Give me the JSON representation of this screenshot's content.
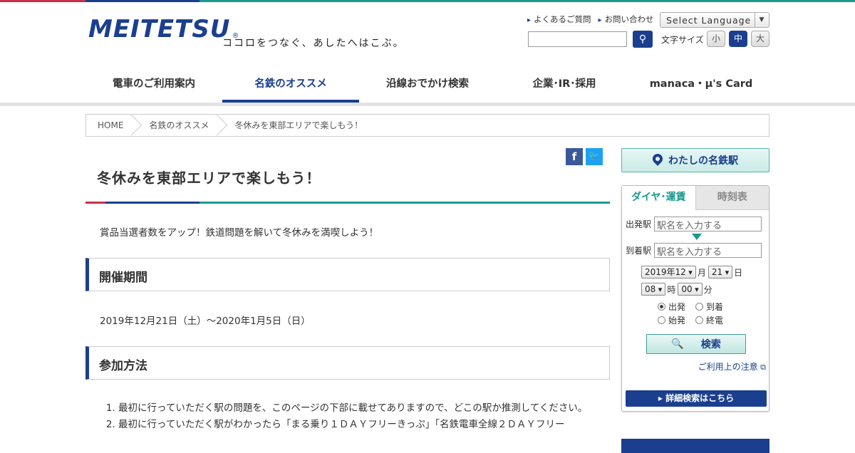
{
  "brand": {
    "name": "MEITETSU",
    "tagline": "ココロをつなぐ、あしたへはこぶ。"
  },
  "utility": {
    "faq": "よくあるご質問",
    "contact": "お問い合わせ",
    "language": "Select Language",
    "font_size_label": "文字サイズ",
    "font_small": "小",
    "font_medium": "中",
    "font_large": "大"
  },
  "gnav": [
    "電車のご利用案内",
    "名鉄のオススメ",
    "沿線おでかけ検索",
    "企業･IR･採用",
    "manaca・μ's Card"
  ],
  "breadcrumb": [
    "HOME",
    "名鉄のオススメ",
    "冬休みを東部エリアで楽しもう！"
  ],
  "main": {
    "title": "冬休みを東部エリアで楽しもう！",
    "lead": "賞品当選者数をアップ！鉄道問題を解いて冬休みを満喫しよう！",
    "section1_title": "開催期間",
    "period": "2019年12月21日（土）～2020年1月5日（日）",
    "section2_title": "参加方法",
    "steps": [
      "最初に行っていただく駅の問題を、このページの下部に載せてありますので、どこの駅か推測してください。",
      "最初に行っていただく駅がわかったら「まる乗り１ＤＡＹフリーきっぷ」「名鉄電車全線２ＤＡＹフリー"
    ]
  },
  "social": {
    "facebook": "f",
    "twitter": "t"
  },
  "sidebar": {
    "my_meitetsu": "わたしの名鉄駅",
    "tab_diagram": "ダイヤ･運賃",
    "tab_timetable": "時刻表",
    "dep_label": "出発駅",
    "arr_label": "到着駅",
    "station_placeholder": "駅名を入力する",
    "year_month": "2019年12",
    "month_unit": "月",
    "day": "21",
    "day_unit": "日",
    "hour": "08",
    "hour_unit": "時",
    "minute": "00",
    "minute_unit": "分",
    "opt_depart": "出発",
    "opt_arrive": "到着",
    "opt_first": "始発",
    "opt_last": "終電",
    "search": "検索",
    "caution": "ご利用上の注意",
    "detail": "詳細検索はこちら"
  },
  "colors": {
    "navy": "#1b3f8e",
    "teal": "#1a9a8d",
    "red": "#c8304a"
  }
}
